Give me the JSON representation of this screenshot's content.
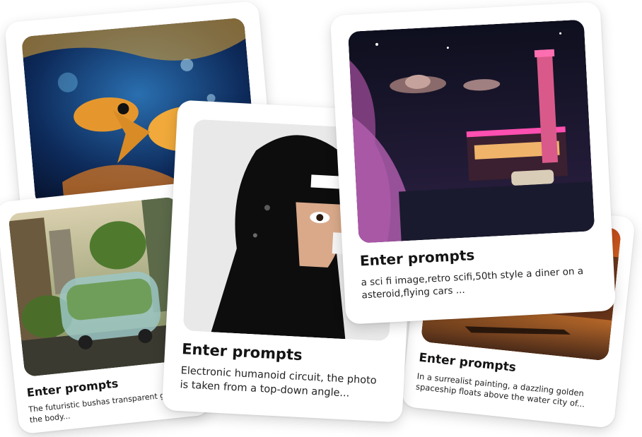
{
  "cards": [
    {
      "title": "Enter prompts",
      "desc": "The futuristic bushas transparent glass on the body...",
      "image": "futuristic-bus-illustration"
    },
    {
      "title": "Enter prompts",
      "desc": "In a surrealist painting, a dazzling golden spaceship floats above the water city of...",
      "image": "venice-canal-illustration"
    },
    {
      "title": "Enter prompts",
      "desc": "",
      "image": "fish-underwater-illustration"
    },
    {
      "title": "Enter prompts",
      "desc": "Electronic humanoid circuit, the photo is taken from a top-down angle...",
      "image": "humanoid-portrait-illustration"
    },
    {
      "title": "Enter prompts",
      "desc": "a sci fi image,retro scifi,50th style a diner on a asteroid,flying cars ...",
      "image": "scifi-diner-illustration"
    }
  ],
  "colors": {
    "card": "#ffffff",
    "text": "#141414"
  }
}
